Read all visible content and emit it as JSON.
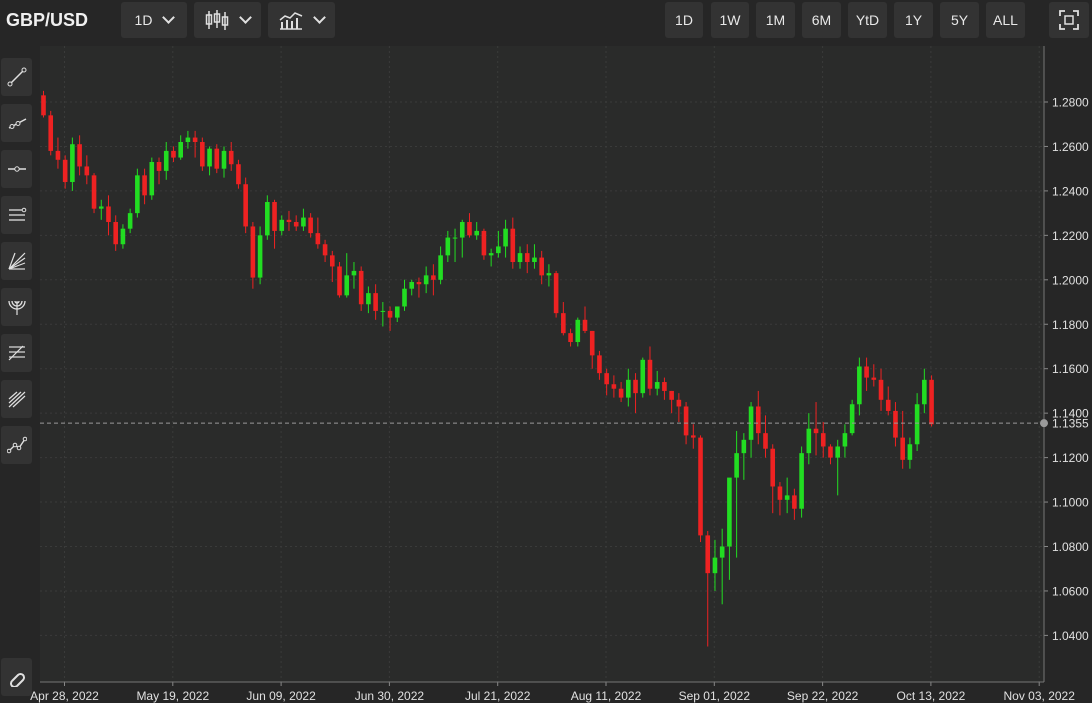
{
  "header": {
    "symbol": "GBP/USD",
    "interval": "1D",
    "ranges": [
      "1D",
      "1W",
      "1M",
      "6M",
      "YtD",
      "1Y",
      "5Y",
      "ALL"
    ]
  },
  "icons": {
    "interval_dropdown": "chevron-down-icon",
    "chart_type": "candlestick-icon",
    "indicators": "indicators-icon",
    "fullscreen": "fullscreen-icon",
    "drawing_tools": [
      "trend-line-icon",
      "ray-icon",
      "horizontal-line-icon",
      "parallel-channel-icon",
      "fib-fan-icon",
      "fib-arcs-icon",
      "fib-retracement-icon",
      "pitchfork-icon",
      "polyline-icon",
      "magnet-icon"
    ]
  },
  "colors": {
    "up": "#22dd22",
    "down": "#ee2222",
    "background": "#2a2b2a",
    "grid": "#3a3b3a"
  },
  "chart_data": {
    "type": "candlestick",
    "title": "GBP/USD",
    "x_tick_labels": [
      "Apr 28, 2022",
      "May 19, 2022",
      "Jun 09, 2022",
      "Jun 30, 2022",
      "Jul 21, 2022",
      "Aug 11, 2022",
      "Sep 01, 2022",
      "Sep 22, 2022",
      "Oct 13, 2022",
      "Nov 03, 2022"
    ],
    "y_ticks": [
      1.04,
      1.06,
      1.08,
      1.1,
      1.12,
      1.14,
      1.16,
      1.18,
      1.2,
      1.22,
      1.24,
      1.26,
      1.28
    ],
    "ylim": [
      1.02,
      1.295
    ],
    "last_price": "1.1355",
    "grid": true,
    "ohlc": [
      [
        1.283,
        1.285,
        1.273,
        1.274
      ],
      [
        1.274,
        1.276,
        1.256,
        1.258
      ],
      [
        1.258,
        1.264,
        1.25,
        1.254
      ],
      [
        1.254,
        1.256,
        1.241,
        1.244
      ],
      [
        1.244,
        1.264,
        1.24,
        1.261
      ],
      [
        1.261,
        1.265,
        1.247,
        1.251
      ],
      [
        1.251,
        1.256,
        1.243,
        1.247
      ],
      [
        1.247,
        1.248,
        1.23,
        1.232
      ],
      [
        1.232,
        1.236,
        1.227,
        1.233
      ],
      [
        1.233,
        1.238,
        1.22,
        1.226
      ],
      [
        1.226,
        1.229,
        1.213,
        1.216
      ],
      [
        1.216,
        1.225,
        1.214,
        1.223
      ],
      [
        1.223,
        1.232,
        1.221,
        1.23
      ],
      [
        1.23,
        1.25,
        1.228,
        1.247
      ],
      [
        1.247,
        1.25,
        1.234,
        1.238
      ],
      [
        1.238,
        1.255,
        1.236,
        1.253
      ],
      [
        1.253,
        1.255,
        1.243,
        1.249
      ],
      [
        1.249,
        1.262,
        1.245,
        1.258
      ],
      [
        1.258,
        1.26,
        1.253,
        1.255
      ],
      [
        1.255,
        1.265,
        1.254,
        1.262
      ],
      [
        1.262,
        1.267,
        1.259,
        1.264
      ],
      [
        1.264,
        1.267,
        1.255,
        1.262
      ],
      [
        1.262,
        1.264,
        1.249,
        1.251
      ],
      [
        1.251,
        1.26,
        1.247,
        1.259
      ],
      [
        1.259,
        1.261,
        1.248,
        1.25
      ],
      [
        1.25,
        1.26,
        1.246,
        1.258
      ],
      [
        1.258,
        1.262,
        1.249,
        1.252
      ],
      [
        1.252,
        1.254,
        1.241,
        1.243
      ],
      [
        1.243,
        1.246,
        1.221,
        1.224
      ],
      [
        1.224,
        1.226,
        1.196,
        1.201
      ],
      [
        1.201,
        1.224,
        1.198,
        1.22
      ],
      [
        1.22,
        1.238,
        1.218,
        1.235
      ],
      [
        1.235,
        1.236,
        1.214,
        1.222
      ],
      [
        1.222,
        1.229,
        1.22,
        1.227
      ],
      [
        1.227,
        1.231,
        1.222,
        1.226
      ],
      [
        1.226,
        1.229,
        1.222,
        1.224
      ],
      [
        1.224,
        1.232,
        1.222,
        1.228
      ],
      [
        1.228,
        1.23,
        1.219,
        1.221
      ],
      [
        1.221,
        1.228,
        1.214,
        1.216
      ],
      [
        1.216,
        1.218,
        1.208,
        1.211
      ],
      [
        1.211,
        1.213,
        1.199,
        1.206
      ],
      [
        1.206,
        1.208,
        1.192,
        1.193
      ],
      [
        1.193,
        1.212,
        1.192,
        1.202
      ],
      [
        1.202,
        1.208,
        1.196,
        1.204
      ],
      [
        1.204,
        1.206,
        1.186,
        1.189
      ],
      [
        1.189,
        1.197,
        1.185,
        1.194
      ],
      [
        1.194,
        1.198,
        1.182,
        1.186
      ],
      [
        1.186,
        1.19,
        1.179,
        1.186
      ],
      [
        1.186,
        1.188,
        1.177,
        1.183
      ],
      [
        1.183,
        1.188,
        1.181,
        1.188
      ],
      [
        1.188,
        1.2,
        1.186,
        1.196
      ],
      [
        1.196,
        1.2,
        1.193,
        1.199
      ],
      [
        1.199,
        1.201,
        1.192,
        1.198
      ],
      [
        1.198,
        1.206,
        1.194,
        1.202
      ],
      [
        1.202,
        1.207,
        1.193,
        1.2
      ],
      [
        1.2,
        1.215,
        1.198,
        1.211
      ],
      [
        1.211,
        1.222,
        1.208,
        1.219
      ],
      [
        1.219,
        1.223,
        1.208,
        1.219
      ],
      [
        1.219,
        1.227,
        1.21,
        1.226
      ],
      [
        1.226,
        1.23,
        1.219,
        1.22
      ],
      [
        1.22,
        1.226,
        1.218,
        1.222
      ],
      [
        1.222,
        1.223,
        1.209,
        1.211
      ],
      [
        1.211,
        1.214,
        1.206,
        1.212
      ],
      [
        1.212,
        1.222,
        1.21,
        1.215
      ],
      [
        1.215,
        1.227,
        1.21,
        1.223
      ],
      [
        1.223,
        1.228,
        1.205,
        1.208
      ],
      [
        1.208,
        1.215,
        1.205,
        1.212
      ],
      [
        1.212,
        1.216,
        1.203,
        1.208
      ],
      [
        1.208,
        1.216,
        1.205,
        1.21
      ],
      [
        1.21,
        1.213,
        1.198,
        1.202
      ],
      [
        1.202,
        1.207,
        1.197,
        1.203
      ],
      [
        1.203,
        1.204,
        1.183,
        1.185
      ],
      [
        1.185,
        1.19,
        1.175,
        1.176
      ],
      [
        1.176,
        1.178,
        1.17,
        1.172
      ],
      [
        1.172,
        1.183,
        1.17,
        1.182
      ],
      [
        1.182,
        1.188,
        1.176,
        1.177
      ],
      [
        1.177,
        1.177,
        1.16,
        1.166
      ],
      [
        1.166,
        1.168,
        1.155,
        1.158
      ],
      [
        1.158,
        1.16,
        1.148,
        1.153
      ],
      [
        1.153,
        1.157,
        1.147,
        1.151
      ],
      [
        1.151,
        1.154,
        1.145,
        1.147
      ],
      [
        1.147,
        1.16,
        1.143,
        1.155
      ],
      [
        1.155,
        1.158,
        1.14,
        1.149
      ],
      [
        1.149,
        1.165,
        1.147,
        1.164
      ],
      [
        1.164,
        1.17,
        1.148,
        1.151
      ],
      [
        1.151,
        1.159,
        1.148,
        1.154
      ],
      [
        1.154,
        1.156,
        1.146,
        1.15
      ],
      [
        1.15,
        1.15,
        1.14,
        1.146
      ],
      [
        1.146,
        1.149,
        1.136,
        1.143
      ],
      [
        1.143,
        1.145,
        1.126,
        1.13
      ],
      [
        1.13,
        1.135,
        1.124,
        1.129
      ],
      [
        1.129,
        1.13,
        1.082,
        1.085
      ],
      [
        1.085,
        1.087,
        1.035,
        1.068
      ],
      [
        1.068,
        1.083,
        1.06,
        1.075
      ],
      [
        1.075,
        1.088,
        1.054,
        1.08
      ],
      [
        1.08,
        1.103,
        1.065,
        1.111
      ],
      [
        1.111,
        1.132,
        1.075,
        1.122
      ],
      [
        1.122,
        1.131,
        1.11,
        1.128
      ],
      [
        1.128,
        1.145,
        1.12,
        1.143
      ],
      [
        1.143,
        1.15,
        1.126,
        1.131
      ],
      [
        1.131,
        1.139,
        1.12,
        1.124
      ],
      [
        1.124,
        1.126,
        1.095,
        1.107
      ],
      [
        1.107,
        1.109,
        1.094,
        1.101
      ],
      [
        1.101,
        1.111,
        1.095,
        1.103
      ],
      [
        1.103,
        1.106,
        1.092,
        1.097
      ],
      [
        1.097,
        1.125,
        1.093,
        1.122
      ],
      [
        1.122,
        1.14,
        1.117,
        1.133
      ],
      [
        1.133,
        1.145,
        1.121,
        1.131
      ],
      [
        1.131,
        1.136,
        1.12,
        1.125
      ],
      [
        1.125,
        1.126,
        1.117,
        1.12
      ],
      [
        1.12,
        1.128,
        1.103,
        1.125
      ],
      [
        1.125,
        1.135,
        1.12,
        1.131
      ],
      [
        1.131,
        1.146,
        1.13,
        1.144
      ],
      [
        1.144,
        1.165,
        1.139,
        1.161
      ],
      [
        1.161,
        1.165,
        1.15,
        1.156
      ],
      [
        1.156,
        1.162,
        1.152,
        1.155
      ],
      [
        1.155,
        1.16,
        1.141,
        1.146
      ],
      [
        1.146,
        1.152,
        1.139,
        1.141
      ],
      [
        1.141,
        1.145,
        1.125,
        1.129
      ],
      [
        1.129,
        1.141,
        1.115,
        1.119
      ],
      [
        1.119,
        1.129,
        1.115,
        1.126
      ],
      [
        1.126,
        1.149,
        1.123,
        1.144
      ],
      [
        1.144,
        1.16,
        1.14,
        1.155
      ],
      [
        1.155,
        1.157,
        1.134,
        1.135
      ]
    ]
  }
}
